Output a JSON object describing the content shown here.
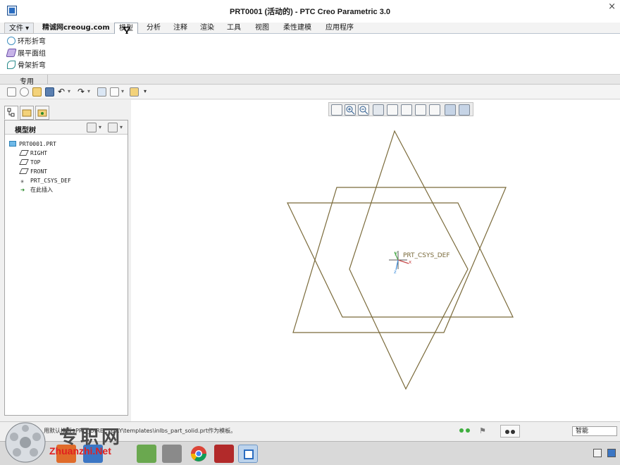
{
  "window": {
    "title": "PRT0001 (活动的) - PTC Creo Parametric 3.0",
    "close_glyph": "×"
  },
  "tabs": [
    {
      "label": "文件 ▾",
      "key": "file"
    },
    {
      "label": "精诚网creoug.com",
      "key": "creoug"
    },
    {
      "label": "模型",
      "key": "model",
      "active": true
    },
    {
      "label": "分析",
      "key": "analysis"
    },
    {
      "label": "注释",
      "key": "annotate"
    },
    {
      "label": "渲染",
      "key": "render"
    },
    {
      "label": "工具",
      "key": "tools"
    },
    {
      "label": "视图",
      "key": "view"
    },
    {
      "label": "柔性建模",
      "key": "flexible"
    },
    {
      "label": "应用程序",
      "key": "apps"
    }
  ],
  "ribbon": {
    "items": [
      {
        "label": "环形折弯",
        "icon": "toroidal-bend-icon"
      },
      {
        "label": "展平面组",
        "icon": "flatten-quilt-icon"
      },
      {
        "label": "骨架折弯",
        "icon": "spinal-bend-icon"
      }
    ],
    "group_label": "专用"
  },
  "quick_access": [
    "new-icon",
    "open-recent-icon",
    "open-icon",
    "save-icon",
    "undo-icon",
    "redo-icon",
    "regenerate-icon",
    "windows-icon",
    "close-window-icon",
    "customize-icon"
  ],
  "model_tree": {
    "title": "模型树",
    "items": [
      {
        "label": "PRT0001.PRT",
        "icon": "part-icon",
        "indent": 0
      },
      {
        "label": "RIGHT",
        "icon": "datum-plane-icon",
        "indent": 1
      },
      {
        "label": "TOP",
        "icon": "datum-plane-icon",
        "indent": 1
      },
      {
        "label": "FRONT",
        "icon": "datum-plane-icon",
        "indent": 1
      },
      {
        "label": "PRT_CSYS_DEF",
        "icon": "csys-icon",
        "indent": 1
      },
      {
        "label": "在此插入",
        "icon": "insert-here-arrow-icon",
        "indent": 1
      }
    ]
  },
  "graphics": {
    "csys_label": "PRT_CSYS_DEF",
    "csys_axes": {
      "x": "x",
      "y": "y",
      "z": "z"
    },
    "plane_color": "#7a6a3a",
    "csys_color": "#7a6a3a"
  },
  "view_toolbar": [
    "refit-icon",
    "zoom-in-icon",
    "zoom-out-icon",
    "repaint-icon",
    "display-style-icon",
    "saved-orientations-icon",
    "view-manager-icon",
    "datum-display-icon",
    "spin-center-icon",
    "annotation-display-icon"
  ],
  "status": {
    "message": "用默认模板$PRO_DIRECTORY\\templates\\inlbs_part_solid.prt作为模板。",
    "selection_filter": "智能"
  },
  "watermark": {
    "text": "专职网",
    "sub": "Zhuanzhi.Net"
  },
  "taskbar": [
    "browser-icon",
    "photos-icon",
    "map-icon",
    "ggc-icon",
    "chrome-icon",
    "screen-recorder-icon",
    "creo-icon"
  ]
}
